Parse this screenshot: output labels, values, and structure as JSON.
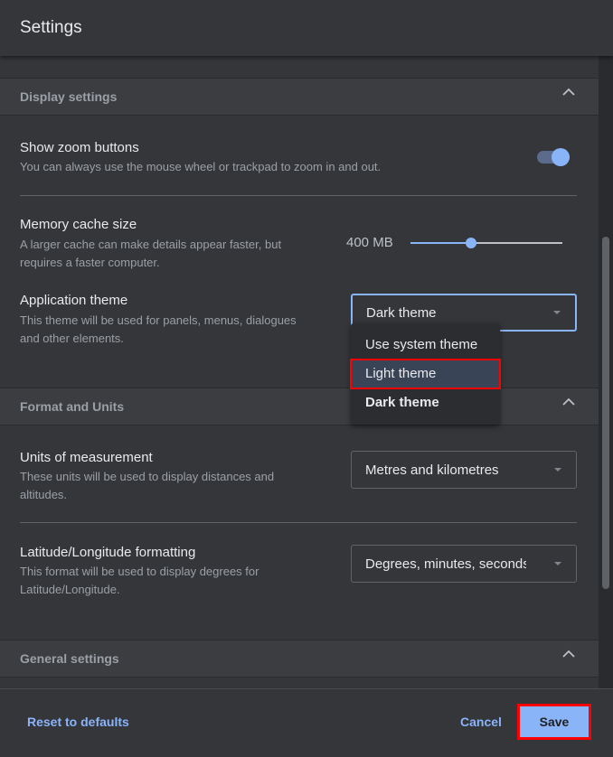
{
  "title": "Settings",
  "display": {
    "header": "Display settings",
    "zoom": {
      "title": "Show zoom buttons",
      "desc": "You can always use the mouse wheel or trackpad to zoom in and out.",
      "enabled": true
    },
    "cache": {
      "title": "Memory cache size",
      "desc1": "A larger cache can make details appear faster, but",
      "desc2": "requires a faster computer.",
      "value": "400 MB",
      "fraction": 0.4
    },
    "theme": {
      "title": "Application theme",
      "desc1": "This theme will be used for panels, menus, dialogues",
      "desc2": "and other elements.",
      "selected": "Dark theme",
      "options": [
        "Use system theme",
        "Light theme",
        "Dark theme"
      ]
    }
  },
  "format": {
    "header": "Format and Units",
    "units": {
      "title": "Units of measurement",
      "desc1": "These units will be used to display distances and",
      "desc2": "altitudes.",
      "selected": "Metres and kilometres"
    },
    "latlon": {
      "title": "Latitude/Longitude formatting",
      "desc1": "This format will be used to display degrees for",
      "desc2": "Latitude/Longitude.",
      "selected": "Degrees, minutes, seconds"
    }
  },
  "general": {
    "header": "General settings"
  },
  "footer": {
    "reset": "Reset to defaults",
    "cancel": "Cancel",
    "save": "Save"
  },
  "colors": {
    "accent": "#8ab4f8",
    "highlight": "#ff0000"
  }
}
